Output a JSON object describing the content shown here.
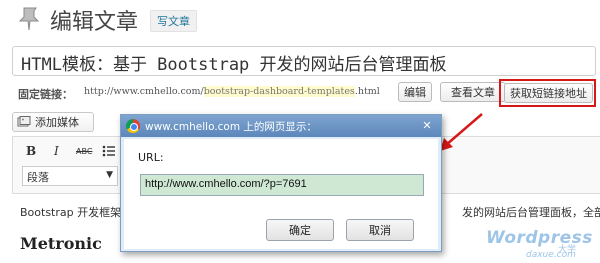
{
  "header": {
    "title": "编辑文章",
    "write_label": "写文章"
  },
  "post_title": "HTML模板：基于 Bootstrap 开发的网站后台管理面板",
  "permalink": {
    "label": "固定链接：",
    "url_prefix": "http://www.cmhello.com/",
    "slug": "bootstrap-dashboard-templates",
    "url_suffix": ".html",
    "edit_label": "编辑",
    "view_label": "查看文章",
    "shortlink_label": "获取短链接地址"
  },
  "media_button_label": "添加媒体",
  "toolbar": {
    "format_value": "段落",
    "bold": "B",
    "italic": "I",
    "strike": "ABC"
  },
  "content": {
    "text_left": "Bootstrap 开发框架",
    "text_right": "发的网站后台管理面板，全部都",
    "heading": "Metronic"
  },
  "dialog": {
    "title": "www.cmhello.com 上的网页显示：",
    "label": "URL:",
    "value": "http://www.cmhello.com/?p=7691",
    "ok_label": "确定",
    "cancel_label": "取消",
    "close_symbol": "✕"
  },
  "watermark": {
    "main": "Wordpress",
    "sub": "大学",
    "domain": "daxue.com"
  },
  "colors": {
    "highlight_box": "#d71818",
    "dialog_titlebar": "#6a93c6",
    "url_field_bg": "#cfe8d4"
  }
}
